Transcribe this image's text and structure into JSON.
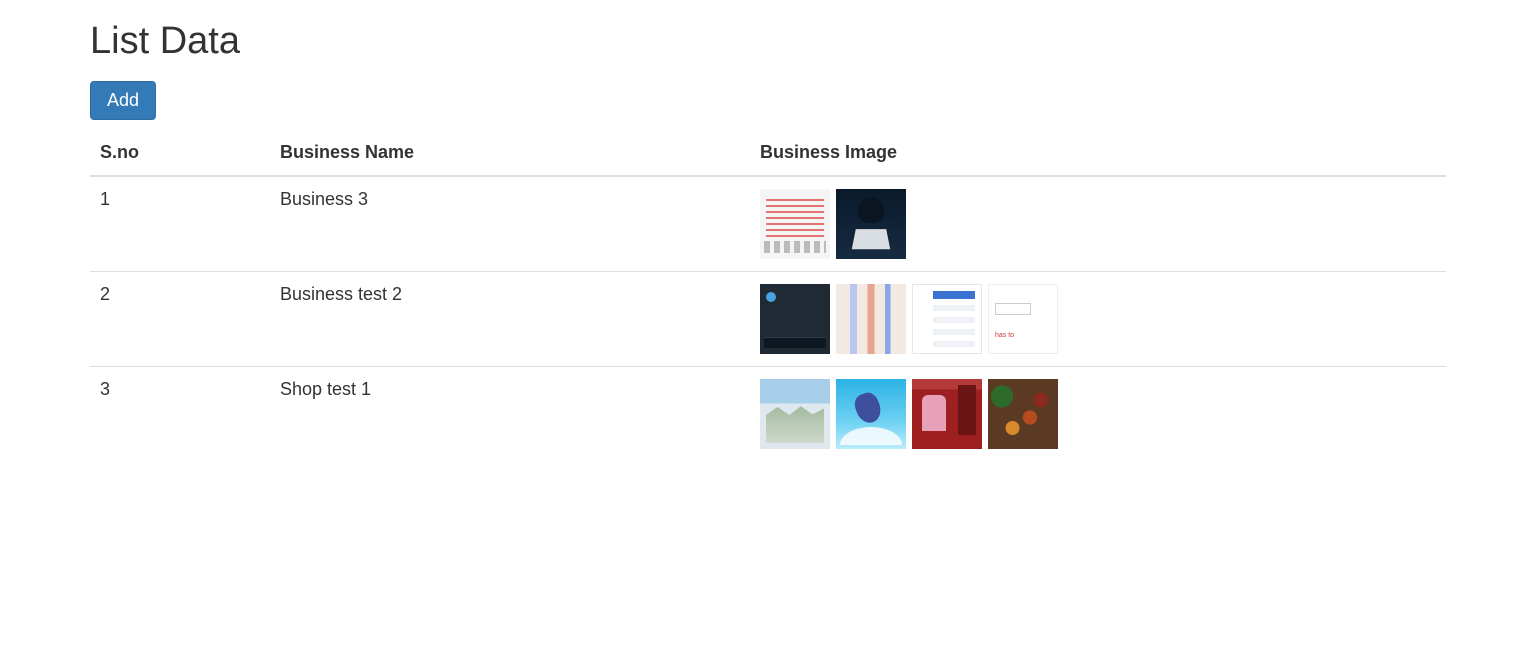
{
  "title": "List Data",
  "buttons": {
    "add": "Add"
  },
  "columns": {
    "sno": "S.no",
    "name": "Business Name",
    "image": "Business Image"
  },
  "rows": [
    {
      "sno": "1",
      "name": "Business 3",
      "image_count": 2
    },
    {
      "sno": "2",
      "name": "Business test 2",
      "image_count": 4
    },
    {
      "sno": "3",
      "name": "Shop test 1",
      "image_count": 4
    }
  ]
}
